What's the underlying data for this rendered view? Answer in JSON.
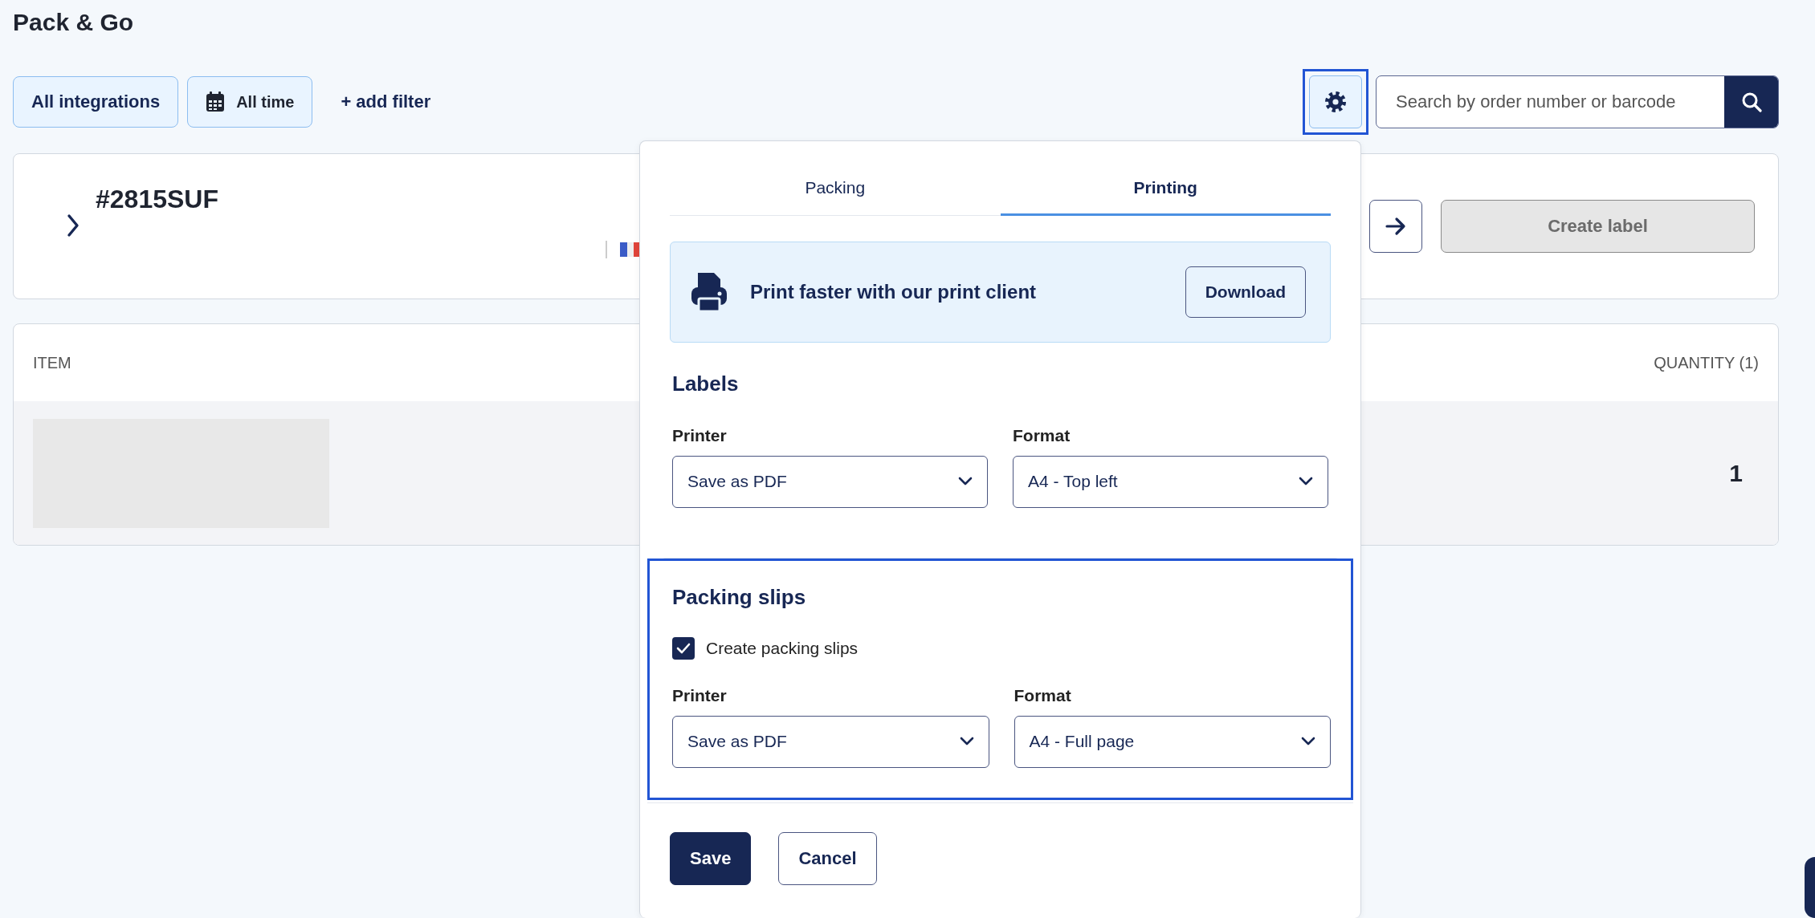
{
  "page": {
    "title": "Pack & Go"
  },
  "filters": [
    {
      "kind": "plain",
      "label": "All integrations"
    },
    {
      "kind": "date",
      "label": "All time"
    }
  ],
  "add_filter": "+ add filter",
  "settings_button": {
    "focused": true
  },
  "search": {
    "placeholder": "Search by order number or barcode"
  },
  "order": {
    "number": "#2815SUF",
    "expanded": false
  },
  "create_label": {
    "label": "Create label",
    "disabled": true
  },
  "items_table": {
    "columns": [
      "ITEM",
      "QUANTITY (1)"
    ],
    "rows": [
      {
        "quantity": "1"
      }
    ]
  },
  "settings_panel": {
    "tabs": [
      {
        "label": "Packing",
        "selected": false
      },
      {
        "label": "Printing",
        "selected": true
      }
    ],
    "banner": {
      "text": "Print faster with our print client",
      "button": "Download"
    },
    "sections": [
      {
        "title": "Labels",
        "highlighted": false,
        "fields": [
          {
            "label": "Printer",
            "value": "Save as PDF"
          },
          {
            "label": "Format",
            "value": "A4 - Top left"
          }
        ]
      },
      {
        "title": "Packing slips",
        "highlighted": true,
        "checkbox": {
          "label": "Create packing slips",
          "checked": true
        },
        "fields": [
          {
            "label": "Printer",
            "value": "Save as PDF"
          },
          {
            "label": "Format",
            "value": "A4 - Full page"
          }
        ]
      }
    ],
    "buttons": [
      {
        "kind": "primary",
        "label": "Save"
      },
      {
        "kind": "secondary",
        "label": "Cancel"
      }
    ]
  }
}
